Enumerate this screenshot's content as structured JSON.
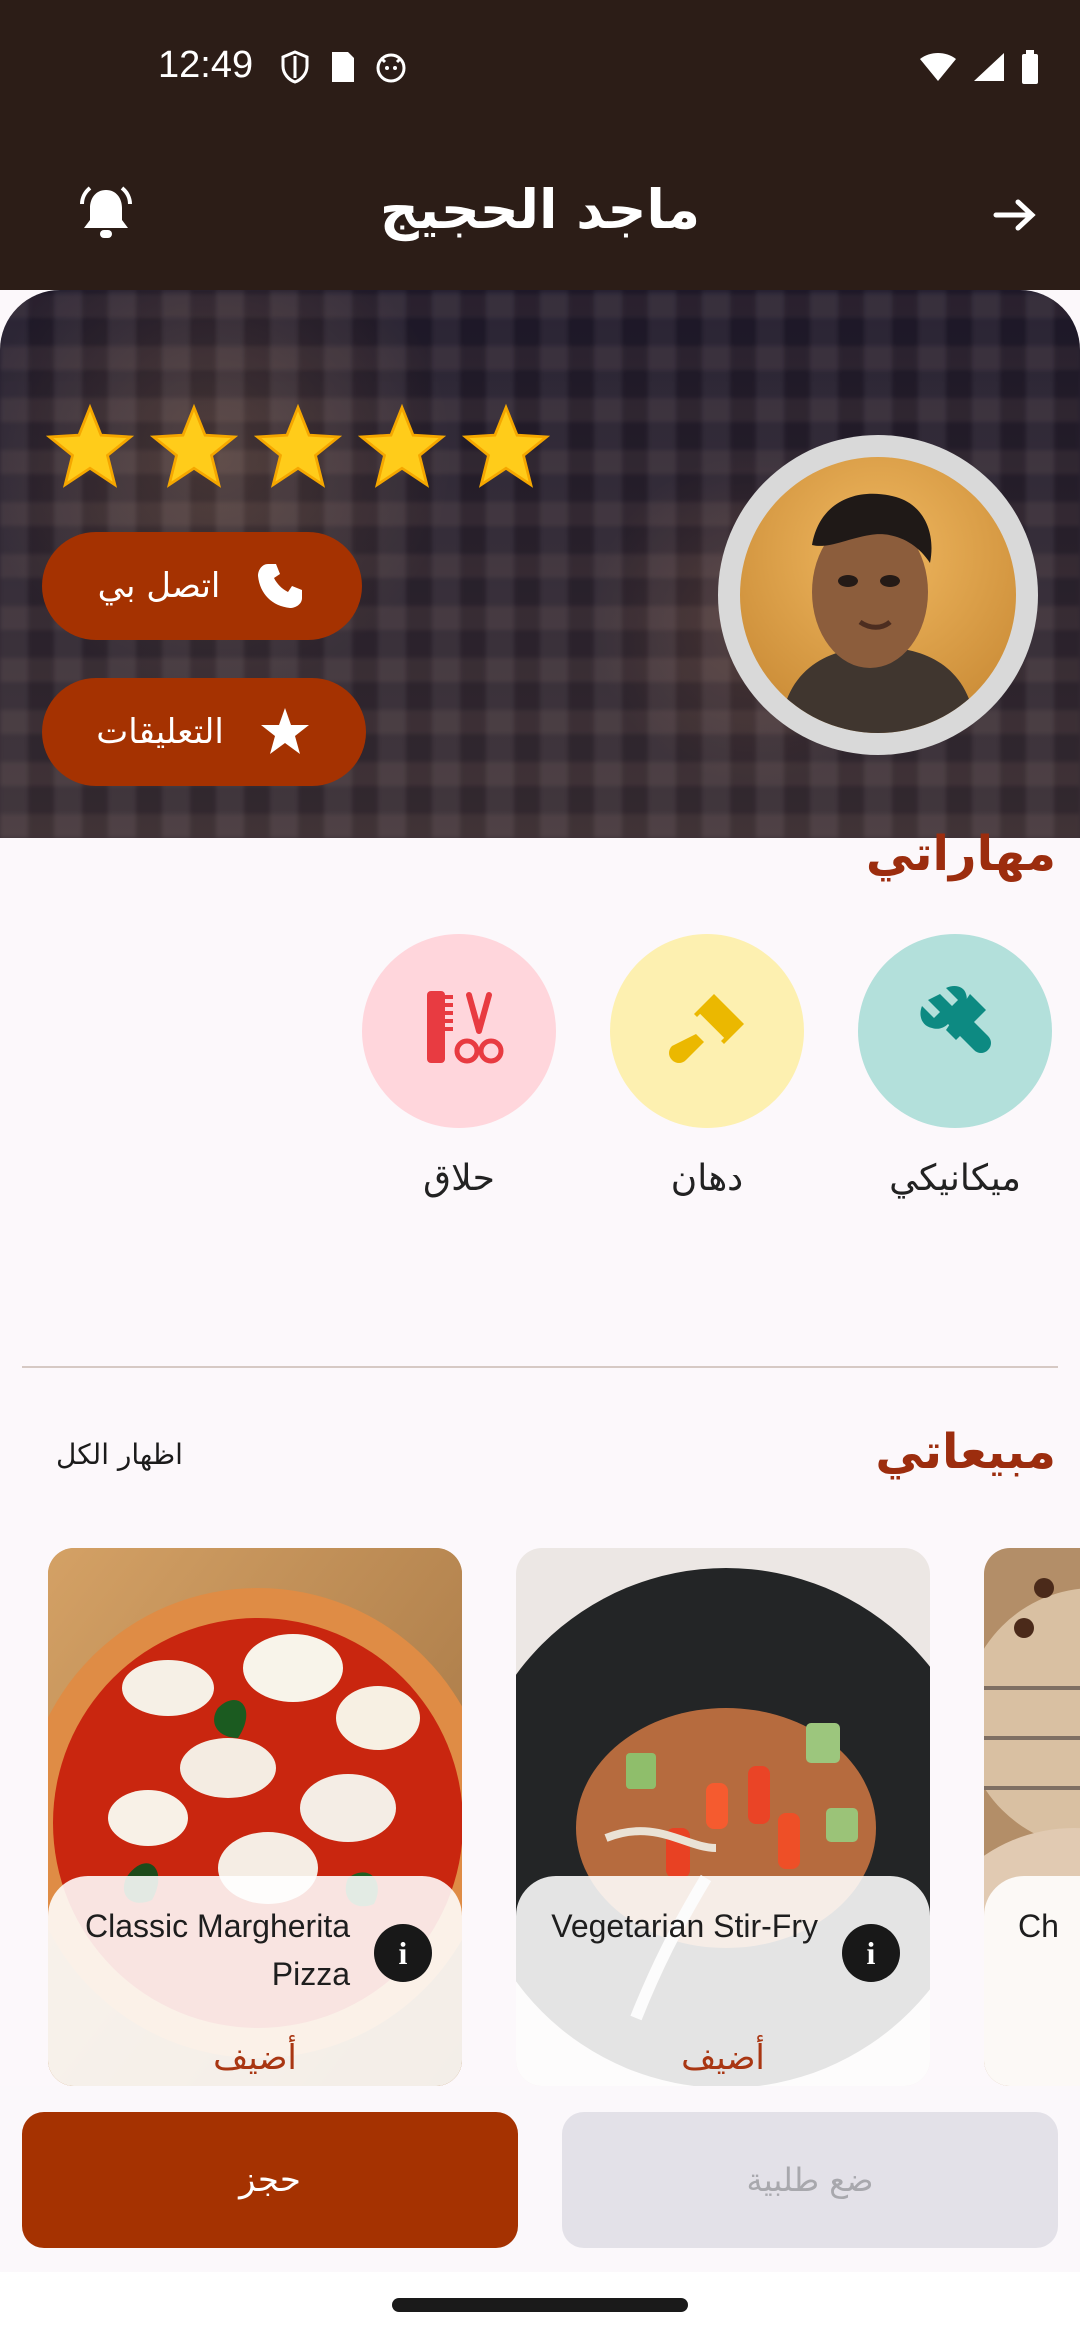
{
  "status": {
    "time": "12:49"
  },
  "header": {
    "title": "ماجد الحجيج"
  },
  "profile": {
    "rating_text": "★★★★★",
    "call_label": "اتصل بي",
    "reviews_label": "التعليقات"
  },
  "skills": {
    "title": "مهاراتي",
    "items": [
      {
        "label": "ميكانيكي",
        "color": "#b3e0db",
        "icon": "wrench-screwdriver-icon"
      },
      {
        "label": "دهان",
        "color": "#fdf0b0",
        "icon": "paint-brush-icon"
      },
      {
        "label": "حلاق",
        "color": "#ffd6dc",
        "icon": "barber-icon"
      }
    ]
  },
  "sales": {
    "title": "مبيعاتي",
    "show_all": "اظهار الكل",
    "items": [
      {
        "name": "Classic Margherita Pizza",
        "add": "أضيف"
      },
      {
        "name": "Vegetarian Stir-Fry",
        "add": "أضيف"
      },
      {
        "name": "Ch"
      }
    ]
  },
  "actions": {
    "book": "حجز",
    "order": "ضع طلبية"
  },
  "colors": {
    "primary": "#a53201",
    "header": "#2c1d17",
    "accent_title": "#9c2d0e"
  }
}
